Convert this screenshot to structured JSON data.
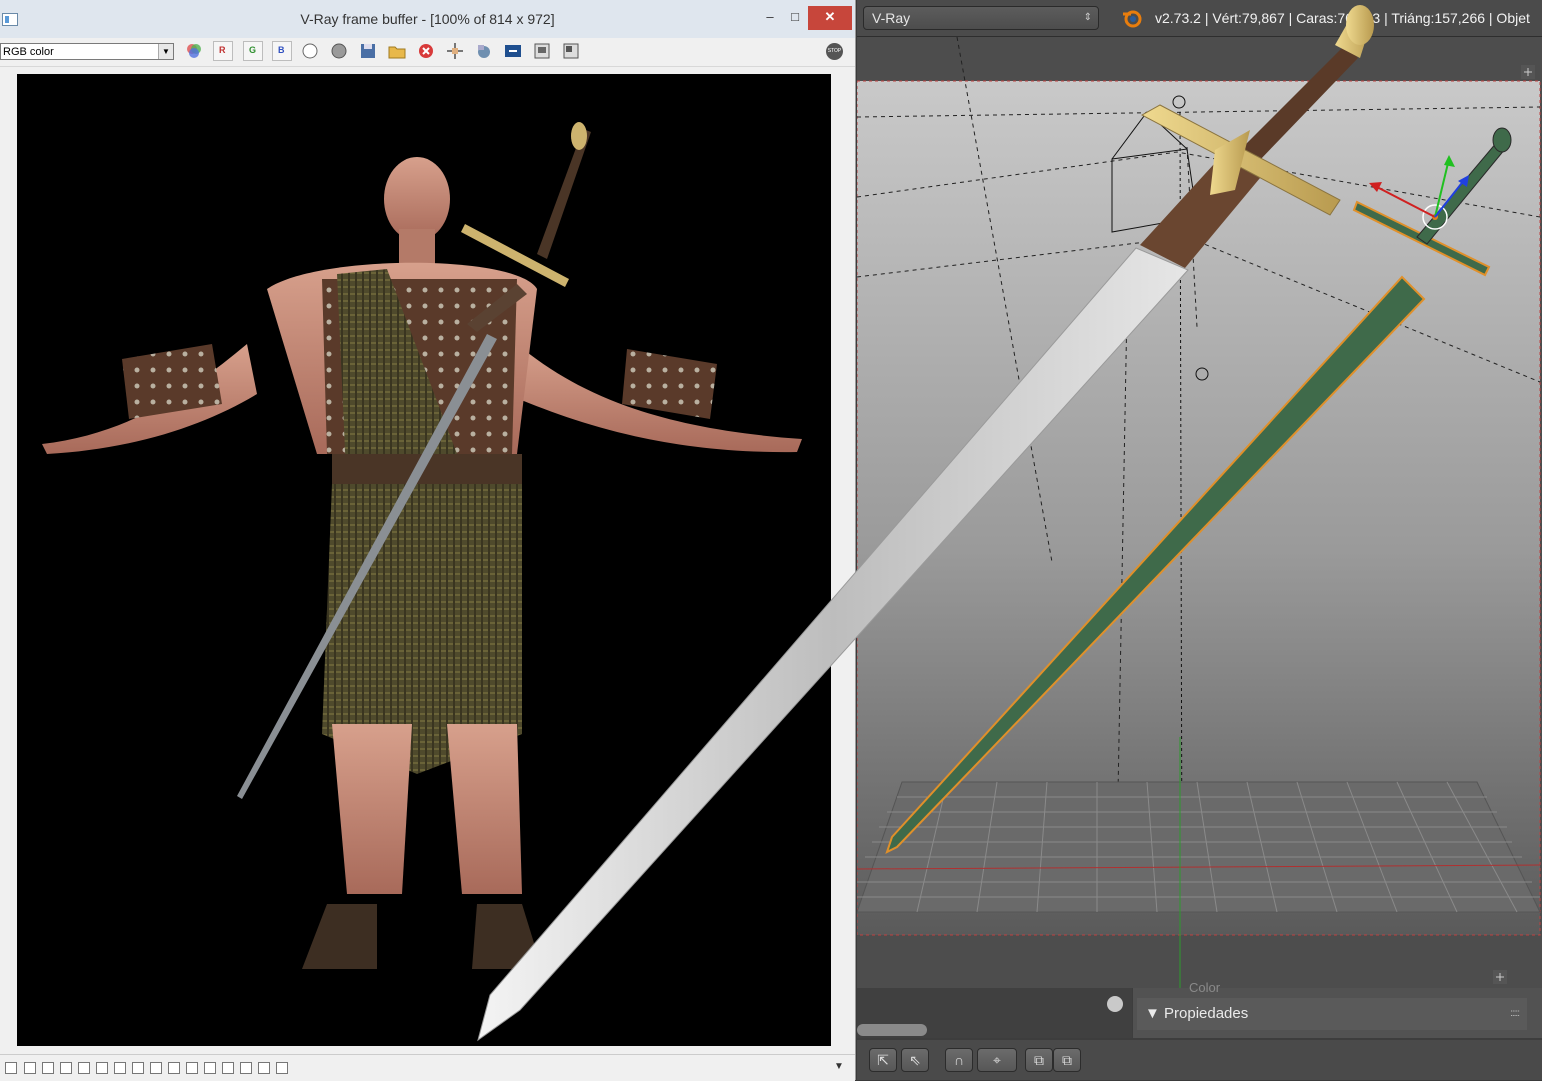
{
  "vfb": {
    "title": "V-Ray frame buffer - [100% of 814 x 972]",
    "window_buttons": {
      "minimize": "‒",
      "maximize": "□",
      "close": "✕"
    },
    "channel_value": "RGB color",
    "toolbar_icons": [
      "rgb-channels-icon",
      "red-channel-icon",
      "green-channel-icon",
      "blue-channel-icon",
      "mono-channel-icon",
      "alpha-channel-icon",
      "save-image-icon",
      "open-image-icon",
      "clear-image-icon",
      "track-mouse-icon",
      "link-to-render-icon",
      "lens-effects-icon",
      "history-icon",
      "region-render-icon"
    ],
    "channel_letters": {
      "r": "R",
      "g": "G",
      "b": "B"
    },
    "stop_label": "STOP",
    "status_dropdown": "▼"
  },
  "blender": {
    "render_engine": "V-Ray",
    "scene_stats": "v2.73.2 | Vért:79,867 | Caras:76,633 | Triáng:157,266 | Objet",
    "properties_color_label": "Color",
    "properties_header": "▼ Propiedades",
    "toolbar_icons": [
      "pin-icon",
      "parent-icon",
      "snap-magnet-icon",
      "snap-target-icon",
      "copy-pose-icon",
      "paste-pose-icon"
    ]
  },
  "colors": {
    "render_bg": "#000000",
    "kilt_plaid": "#4f4a2c",
    "skin": "#c98a78",
    "blade_steel": "#dcdcdc",
    "gold_guard": "#d8bf7a",
    "blender_blade_green": "#3f6a4a",
    "blender_outline_orange": "#e0902a"
  }
}
